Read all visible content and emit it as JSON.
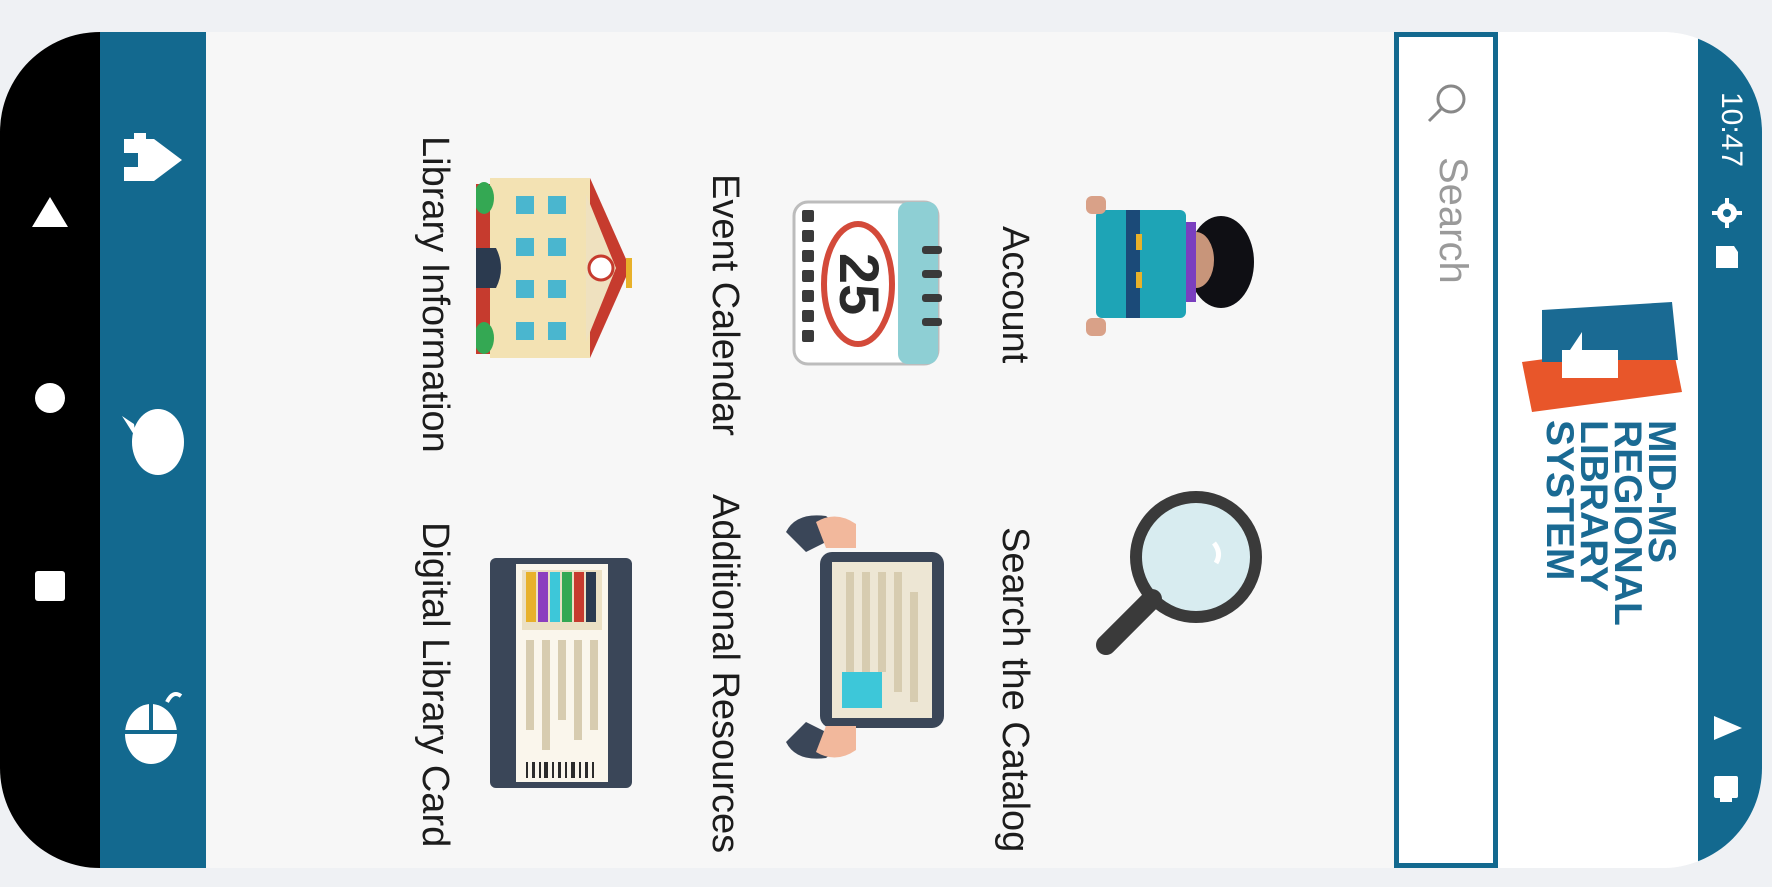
{
  "status_bar": {
    "time": "10:47",
    "icons": [
      "gear-icon",
      "sd-card-icon",
      "wifi-icon",
      "battery-icon"
    ]
  },
  "header": {
    "logo_lines": "MID-MS\nREGIONAL\nLIBRARY\nSYSTEM",
    "logo_icon": "library-logo-icon"
  },
  "search": {
    "placeholder": "Search",
    "icon": "search-icon"
  },
  "tiles": [
    {
      "label": "Account",
      "icon": "person-reading-icon"
    },
    {
      "label": "Search the Catalog",
      "icon": "magnifying-glass-icon"
    },
    {
      "label": "Event Calendar",
      "icon": "calendar-icon"
    },
    {
      "label": "Additional Resources",
      "icon": "tablet-icon"
    },
    {
      "label": "Library Information",
      "icon": "library-building-icon"
    },
    {
      "label": "Digital Library Card",
      "icon": "library-card-icon"
    }
  ],
  "sidebar": {
    "items": [
      "home-icon",
      "chat-icon",
      "mouse-icon"
    ]
  },
  "nav": {
    "items": [
      "back-icon",
      "home-circle-icon",
      "recents-icon"
    ]
  },
  "colors": {
    "primary": "#13698f",
    "logo_orange": "#e8562a",
    "content_bg": "#f7f7f7"
  }
}
